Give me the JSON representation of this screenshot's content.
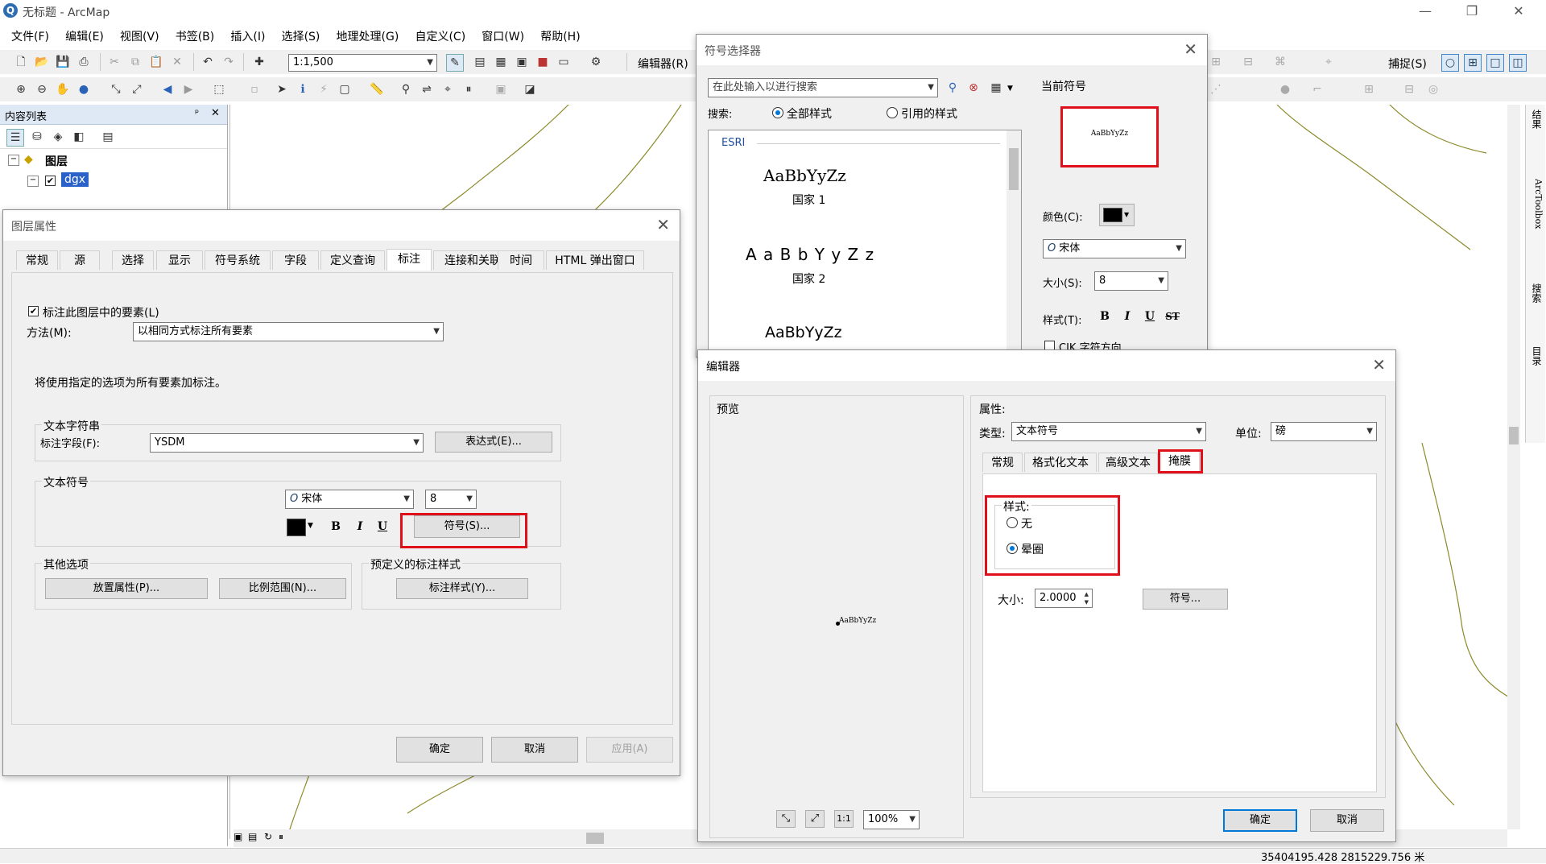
{
  "window": {
    "title": "无标题 - ArcMap",
    "logo": "Q",
    "minimize": "—",
    "restore": "❐",
    "close": "✕"
  },
  "menu": [
    "文件(F)",
    "编辑(E)",
    "视图(V)",
    "书签(B)",
    "插入(I)",
    "选择(S)",
    "地理处理(G)",
    "自定义(C)",
    "窗口(W)",
    "帮助(H)"
  ],
  "toolbar": {
    "scale": "1:1,500",
    "editor_label": "编辑器(R)",
    "snap_label": "捕捉(S)"
  },
  "toc": {
    "title": "内容列表",
    "pin": "ᵖ",
    "close": "✕",
    "layers_label": "图层",
    "layer_name": "dgx"
  },
  "side_tabs": [
    "结果",
    "ArcToolbox",
    "搜索",
    "目录"
  ],
  "status": {
    "coords": "35404195.428  2815229.756 米"
  },
  "layer_props": {
    "title": "图层属性",
    "tabs": [
      "常规",
      "源",
      "选择",
      "显示",
      "符号系统",
      "字段",
      "定义查询",
      "标注",
      "连接和关联",
      "时间",
      "HTML 弹出窗口"
    ],
    "active_tab": "标注",
    "label_check": "标注此图层中的要素(L)",
    "method_label": "方法(M):",
    "method_value": "以相同方式标注所有要素",
    "info_text": "将使用指定的选项为所有要素加标注。",
    "text_string_group": "文本字符串",
    "label_field_label": "标注字段(F):",
    "label_field_value": "YSDM",
    "expression_btn": "表达式(E)...",
    "text_symbol_group": "文本符号",
    "font": "宋体",
    "size": "8",
    "symbol_btn": "符号(S)...",
    "other_group": "其他选项",
    "placement_btn": "放置属性(P)...",
    "scale_btn": "比例范围(N)...",
    "predef_group": "预定义的标注样式",
    "label_style_btn": "标注样式(Y)...",
    "ok": "确定",
    "cancel": "取消",
    "apply": "应用(A)"
  },
  "symbol_selector": {
    "title": "符号选择器",
    "search_placeholder": "在此处输入以进行搜索",
    "search_label": "搜索:",
    "opt_all": "全部样式",
    "opt_ref": "引用的样式",
    "group_name": "ESRI",
    "items": [
      {
        "sample": "AaBbYyZz",
        "name": "国家 1"
      },
      {
        "sample": "A a B b Y y Z z",
        "name": "国家 2"
      },
      {
        "sample": "AaBbYyZz",
        "name": ""
      }
    ],
    "current_label": "当前符号",
    "current_sample": "AaBbYyZz",
    "color_label": "颜色(C):",
    "font": "宋体",
    "size_label": "大小(S):",
    "size": "8",
    "style_label": "样式(T):",
    "cjk_label": "CJK 字符方向"
  },
  "editor": {
    "title": "编辑器",
    "preview_label": "预览",
    "preview_sample": "AaBbYyZz",
    "zoom": "100%",
    "props_label": "属性:",
    "type_label": "类型:",
    "type_value": "文本符号",
    "unit_label": "单位:",
    "unit_value": "磅",
    "tabs": [
      "常规",
      "格式化文本",
      "高级文本",
      "掩膜"
    ],
    "active_tab": "掩膜",
    "style_group": "样式:",
    "opt_none": "无",
    "opt_halo": "晕圈",
    "size_label": "大小:",
    "size_value": "2.0000",
    "symbol_btn": "符号...",
    "ok": "确定",
    "cancel": "取消"
  }
}
